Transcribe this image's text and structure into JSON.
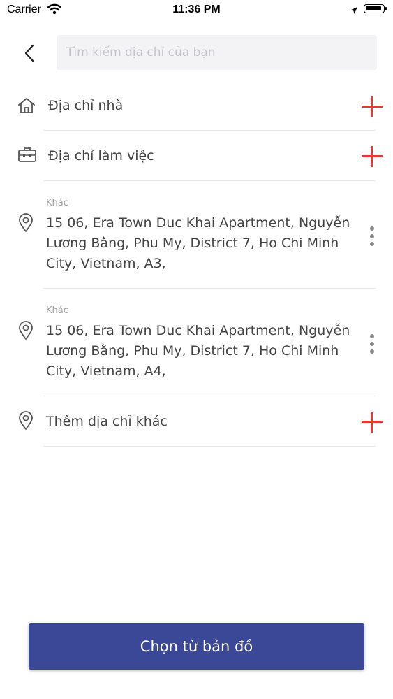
{
  "status_bar": {
    "carrier": "Carrier",
    "time": "11:36 PM"
  },
  "search": {
    "placeholder": "Tìm kiếm địa chỉ của bạn",
    "value": ""
  },
  "home": {
    "label": "Địa chỉ nhà",
    "icon": "home-icon"
  },
  "work": {
    "label": "Địa chỉ làm việc",
    "icon": "briefcase-icon"
  },
  "addresses": [
    {
      "caption": "Khác",
      "text": "15 06, Era Town Duc Khai Apartment, Nguyễn Lương Bằng, Phu My, District 7, Ho Chi Minh City, Vietnam, A3,"
    },
    {
      "caption": "Khác",
      "text": "15 06, Era Town Duc Khai Apartment, Nguyễn Lương Bằng, Phu My, District 7, Ho Chi Minh City, Vietnam, A4,"
    }
  ],
  "add_other": {
    "label": "Thêm địa chỉ khác"
  },
  "map_button": {
    "label": "Chọn từ bản đồ"
  },
  "colors": {
    "accent_red": "#e53935",
    "primary_button": "#3b4897",
    "search_bg": "#f3f3f5"
  }
}
